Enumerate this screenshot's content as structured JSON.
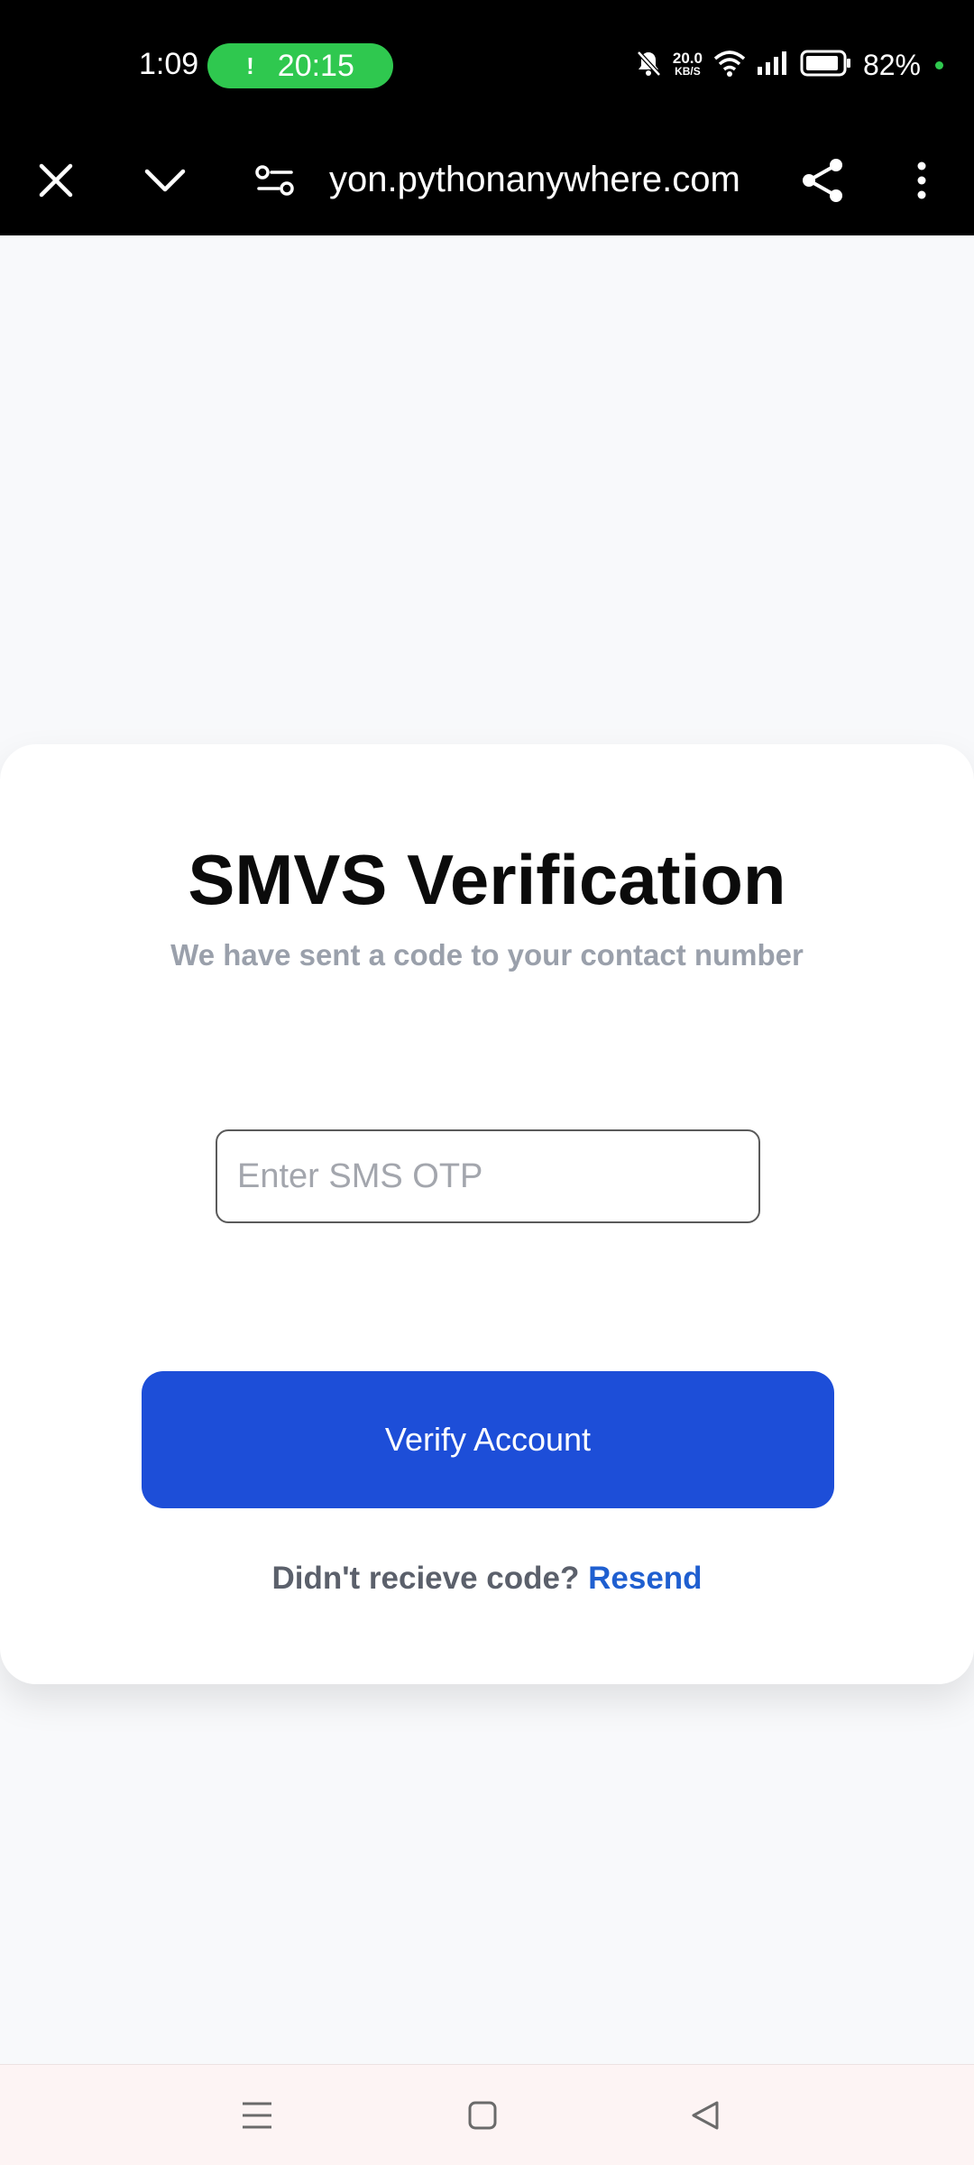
{
  "status_bar": {
    "time": "1:09",
    "call_timer": "20:15",
    "net_speed_value": "20.0",
    "net_speed_unit": "KB/S",
    "battery_percent": "82%"
  },
  "browser": {
    "url": "yon.pythonanywhere.com"
  },
  "card": {
    "title": "SMVS Verification",
    "subtitle": "We have sent a code to your contact number",
    "otp_placeholder": "Enter SMS OTP",
    "otp_value": "",
    "verify_label": "Verify Account",
    "resend_prompt": "Didn't recieve code?",
    "resend_link": "Resend"
  },
  "colors": {
    "primary_button": "#1d4ed8",
    "link": "#1f5fd0",
    "call_pill": "#2fc84f"
  },
  "icons": [
    "close-icon",
    "chevron-down-icon",
    "site-settings-icon",
    "share-icon",
    "more-vert-icon",
    "mute-icon",
    "wifi-icon",
    "signal-icon",
    "battery-icon",
    "menu-icon",
    "home-icon",
    "back-icon"
  ]
}
